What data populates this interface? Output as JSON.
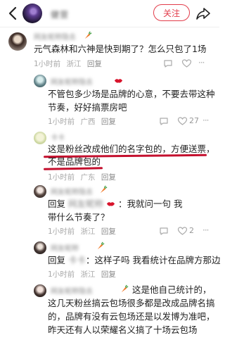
{
  "header": {
    "name": "健营",
    "follow_label": "关注"
  },
  "comments": [
    {
      "author": "网友昵称隐去",
      "text": "元气森林和六神是快到期了？怎么只包了1场",
      "time": "1小时前",
      "location": "浙江",
      "reply_label": "回复"
    },
    {
      "author": "网友昵称隐去",
      "text_line1": "不管包多少场是品牌的心意，不要去带这种",
      "text_line2": "节奏，好好搞票房吧",
      "time": "1小时前",
      "location": "广西",
      "reply_label": "回复",
      "likes": "27"
    },
    {
      "author": "卡卡",
      "text_line1": "这是粉丝改成他们的名字包的，方便送票，",
      "text_line2": "不是品牌包的",
      "time": "1小时前",
      "location": "广东",
      "reply_label": "回复"
    },
    {
      "author": "网友昵称隐去",
      "text_line1": "回复",
      "text_hidden": "网友昵称",
      "text_line1b": "：我就问一句 我",
      "text_line2": "带什么节奏了？",
      "time": "1小时前",
      "location": "浙江",
      "reply_label": "回复",
      "likes": "2"
    },
    {
      "author": "网友昵称",
      "text_line1a": "回复",
      "text_hidden": "卡卡",
      "text_line1b": "：这样子吗 我看统计在品牌方那边",
      "time": "1小时前",
      "location": "浙江",
      "reply_label": "回复"
    },
    {
      "author": "网友昵称隐去",
      "text_line1": "这是他自己统计的，",
      "text_line2": "这几天粉丝搞云包场很多都是改成品牌名搞",
      "text_line3": "的，品牌有没有云包场还是以发博为准吧，",
      "text_line4": "昨天还有人以荣耀名义搞了十场云包场"
    }
  ],
  "colors": {
    "accent": "#e23c4a",
    "underline": "#c4102e"
  }
}
